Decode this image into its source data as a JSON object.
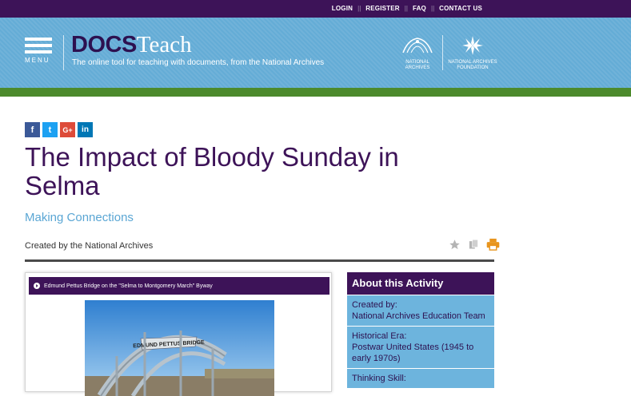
{
  "top_nav": {
    "links": [
      "LOGIN",
      "REGISTER",
      "FAQ",
      "CONTACT US"
    ]
  },
  "header": {
    "menu_label": "MENU",
    "logo_docs": "DOCS",
    "logo_teach": "Teach",
    "tagline": "The online tool for teaching with documents, from the National Archives",
    "na_logo_text": "NATIONAL ARCHIVES",
    "naf_logo_text": "NATIONAL ARCHIVES FOUNDATION"
  },
  "social": {
    "icons": [
      "facebook-icon",
      "twitter-icon",
      "google-plus-icon",
      "linkedin-icon"
    ],
    "glyphs": [
      "f",
      "t",
      "G+",
      "in"
    ],
    "colors": [
      "#3b5998",
      "#1da1f2",
      "#dd4b39",
      "#0077b5"
    ]
  },
  "activity": {
    "title": "The Impact of Bloody Sunday in Selma",
    "type": "Making Connections",
    "created_by": "Created by the National Archives"
  },
  "tools": {
    "icons": [
      "star-icon",
      "copy-icon",
      "print-icon"
    ]
  },
  "document_card": {
    "caption": "Edmund Pettus Bridge on the \"Selma to Montgomery March\" Byway",
    "bridge_sign": "EDMUND PETTUS BRIDGE"
  },
  "about": {
    "heading": "About this Activity",
    "rows": [
      {
        "label": "Created by:",
        "value": "National Archives Education Team"
      },
      {
        "label": "Historical Era:",
        "value": "Postwar United States (1945 to early 1970s)"
      },
      {
        "label": "Thinking Skill:",
        "value": ""
      }
    ]
  },
  "colors": {
    "purple": "#3d1358",
    "header_blue": "#64acd6",
    "green_bar": "#4c8a2c",
    "link_blue": "#5aa6d4",
    "print_orange": "#e8951e"
  }
}
